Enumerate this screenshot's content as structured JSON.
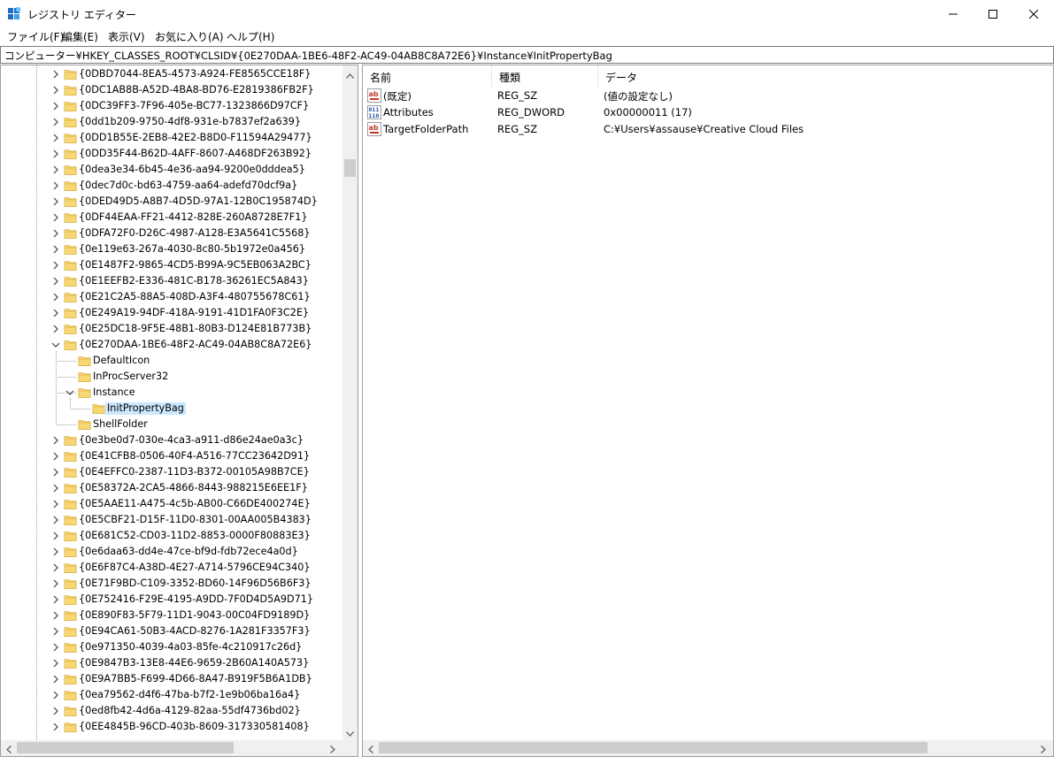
{
  "window": {
    "title": "レジストリ エディター",
    "icon": "registry-editor-icon"
  },
  "menu": [
    {
      "label": "ファイル(F)"
    },
    {
      "label": "編集(E)"
    },
    {
      "label": "表示(V)"
    },
    {
      "label": "お気に入り(A)"
    },
    {
      "label": "ヘルプ(H)"
    }
  ],
  "address": "コンピューター¥HKEY_CLASSES_ROOT¥CLSID¥{0E270DAA-1BE6-48F2-AC49-04AB8C8A72E6}¥Instance¥InitPropertyBag",
  "tree": [
    {
      "label": "{0DBD7044-8EA5-4573-A924-FE8565CCE18F}",
      "level": 0,
      "expander": "collapsed"
    },
    {
      "label": "{0DC1AB8B-A52D-4BA8-BD76-E2819386FB2F}",
      "level": 0,
      "expander": "collapsed"
    },
    {
      "label": "{0DC39FF3-7F96-405e-BC77-1323866D97CF}",
      "level": 0,
      "expander": "collapsed"
    },
    {
      "label": "{0dd1b209-9750-4df8-931e-b7837ef2a639}",
      "level": 0,
      "expander": "collapsed"
    },
    {
      "label": "{0DD1B55E-2EB8-42E2-B8D0-F11594A29477}",
      "level": 0,
      "expander": "collapsed"
    },
    {
      "label": "{0DD35F44-B62D-4AFF-8607-A468DF263B92}",
      "level": 0,
      "expander": "collapsed"
    },
    {
      "label": "{0dea3e34-6b45-4e36-aa94-9200e0dddea5}",
      "level": 0,
      "expander": "collapsed"
    },
    {
      "label": "{0dec7d0c-bd63-4759-aa64-adefd70dcf9a}",
      "level": 0,
      "expander": "collapsed"
    },
    {
      "label": "{0DED49D5-A8B7-4D5D-97A1-12B0C195874D}",
      "level": 0,
      "expander": "collapsed"
    },
    {
      "label": "{0DF44EAA-FF21-4412-828E-260A8728E7F1}",
      "level": 0,
      "expander": "collapsed"
    },
    {
      "label": "{0DFA72F0-D26C-4987-A128-E3A5641C5568}",
      "level": 0,
      "expander": "collapsed"
    },
    {
      "label": "{0e119e63-267a-4030-8c80-5b1972e0a456}",
      "level": 0,
      "expander": "collapsed"
    },
    {
      "label": "{0E1487F2-9865-4CD5-B99A-9C5EB063A2BC}",
      "level": 0,
      "expander": "collapsed"
    },
    {
      "label": "{0E1EEFB2-E336-481C-B178-36261EC5A843}",
      "level": 0,
      "expander": "collapsed"
    },
    {
      "label": "{0E21C2A5-88A5-408D-A3F4-480755678C61}",
      "level": 0,
      "expander": "collapsed"
    },
    {
      "label": "{0E249A19-94DF-418A-9191-41D1FA0F3C2E}",
      "level": 0,
      "expander": "collapsed"
    },
    {
      "label": "{0E25DC18-9F5E-48B1-80B3-D124E81B773B}",
      "level": 0,
      "expander": "collapsed"
    },
    {
      "label": "{0E270DAA-1BE6-48F2-AC49-04AB8C8A72E6}",
      "level": 0,
      "expander": "expanded"
    },
    {
      "label": "DefaultIcon",
      "level": 1,
      "expander": "none"
    },
    {
      "label": "InProcServer32",
      "level": 1,
      "expander": "none"
    },
    {
      "label": "Instance",
      "level": 1,
      "expander": "expanded"
    },
    {
      "label": "InitPropertyBag",
      "level": 2,
      "expander": "none",
      "selected": true
    },
    {
      "label": "ShellFolder",
      "level": 1,
      "expander": "none"
    },
    {
      "label": "{0e3be0d7-030e-4ca3-a911-d86e24ae0a3c}",
      "level": 0,
      "expander": "collapsed"
    },
    {
      "label": "{0E41CFB8-0506-40F4-A516-77CC23642D91}",
      "level": 0,
      "expander": "collapsed"
    },
    {
      "label": "{0E4EFFC0-2387-11D3-B372-00105A98B7CE}",
      "level": 0,
      "expander": "collapsed"
    },
    {
      "label": "{0E58372A-2CA5-4866-8443-988215E6EE1F}",
      "level": 0,
      "expander": "collapsed"
    },
    {
      "label": "{0E5AAE11-A475-4c5b-AB00-C66DE400274E}",
      "level": 0,
      "expander": "collapsed"
    },
    {
      "label": "{0E5CBF21-D15F-11D0-8301-00AA005B4383}",
      "level": 0,
      "expander": "collapsed"
    },
    {
      "label": "{0E681C52-CD03-11D2-8853-0000F80883E3}",
      "level": 0,
      "expander": "collapsed"
    },
    {
      "label": "{0e6daa63-dd4e-47ce-bf9d-fdb72ece4a0d}",
      "level": 0,
      "expander": "collapsed"
    },
    {
      "label": "{0E6F87C4-A38D-4E27-A714-5796CE94C340}",
      "level": 0,
      "expander": "collapsed"
    },
    {
      "label": "{0E71F9BD-C109-3352-BD60-14F96D56B6F3}",
      "level": 0,
      "expander": "collapsed"
    },
    {
      "label": "{0E752416-F29E-4195-A9DD-7F0D4D5A9D71}",
      "level": 0,
      "expander": "collapsed"
    },
    {
      "label": "{0E890F83-5F79-11D1-9043-00C04FD9189D}",
      "level": 0,
      "expander": "collapsed"
    },
    {
      "label": "{0E94CA61-50B3-4ACD-8276-1A281F3357F3}",
      "level": 0,
      "expander": "collapsed"
    },
    {
      "label": "{0e971350-4039-4a03-85fe-4c210917c26d}",
      "level": 0,
      "expander": "collapsed"
    },
    {
      "label": "{0E9847B3-13E8-44E6-9659-2B60A140A573}",
      "level": 0,
      "expander": "collapsed"
    },
    {
      "label": "{0E9A7BB5-F699-4D66-8A47-B919F5B6A1DB}",
      "level": 0,
      "expander": "collapsed"
    },
    {
      "label": "{0ea79562-d4f6-47ba-b7f2-1e9b06ba16a4}",
      "level": 0,
      "expander": "collapsed"
    },
    {
      "label": "{0ed8fb42-4d6a-4129-82aa-55df4736bd02}",
      "level": 0,
      "expander": "collapsed"
    },
    {
      "label": "{0EE4845B-96CD-403b-8609-317330581408}",
      "level": 0,
      "expander": "collapsed"
    }
  ],
  "columns": {
    "name": "名前",
    "type": "種類",
    "data": "データ"
  },
  "values": [
    {
      "icon": "string-value-icon",
      "name": "(既定)",
      "type": "REG_SZ",
      "data": "(値の設定なし)"
    },
    {
      "icon": "binary-value-icon",
      "name": "Attributes",
      "type": "REG_DWORD",
      "data": "0x00000011 (17)"
    },
    {
      "icon": "string-value-icon",
      "name": "TargetFolderPath",
      "type": "REG_SZ",
      "data": "C:¥Users¥assause¥Creative Cloud Files"
    }
  ],
  "colors": {
    "selection": "#cce8ff",
    "folder": "#f8d775",
    "folder_edge": "#dcb54a"
  }
}
